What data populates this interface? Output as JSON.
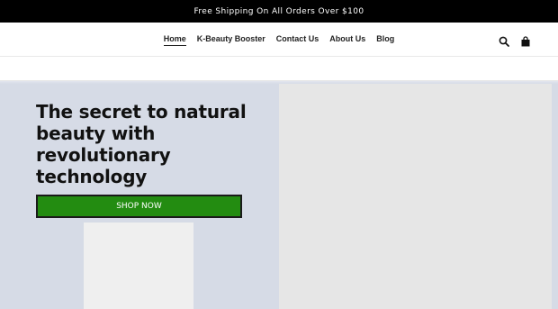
{
  "announcement": "Free Shipping On All Orders Over $100",
  "nav": {
    "items": [
      "Home",
      "K-Beauty Booster",
      "Contact Us",
      "About Us",
      "Blog"
    ],
    "active": "Home"
  },
  "icons": {
    "search": "search-icon",
    "cart": "cart-icon"
  },
  "hero": {
    "title": "The secret to natural beauty with revolutionary technology",
    "button_label": "SHOP NOW"
  },
  "colors": {
    "announcement_bg": "#000000",
    "hero_bg": "#d6dbe6",
    "button_bg": "#238c11"
  }
}
